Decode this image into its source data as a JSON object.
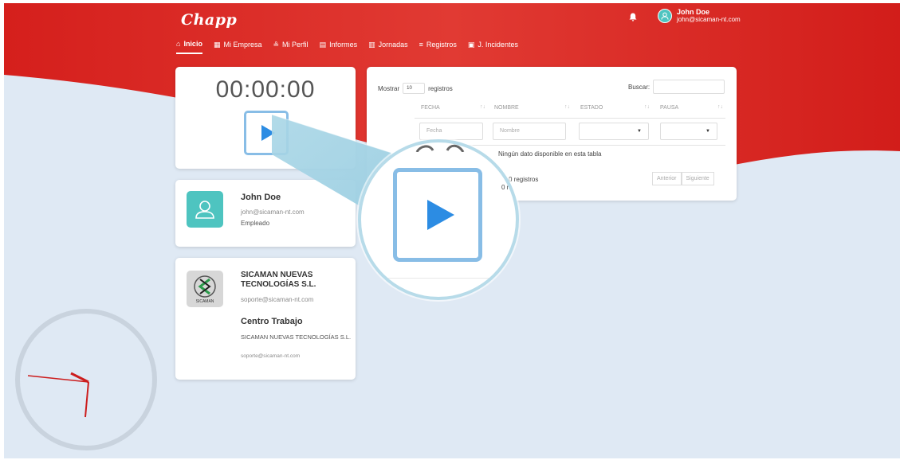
{
  "brand": {
    "logo": "Chapp",
    "accent": "#d8231f",
    "accent_light": "#e8403a"
  },
  "nav": [
    {
      "label": "Inicio",
      "icon": "home-icon",
      "active": true
    },
    {
      "label": "Mi Empresa",
      "icon": "building-icon"
    },
    {
      "label": "Mi Perfil",
      "icon": "person-icon"
    },
    {
      "label": "Informes",
      "icon": "document-icon"
    },
    {
      "label": "Jornadas",
      "icon": "calendar-icon"
    },
    {
      "label": "Registros",
      "icon": "list-icon"
    },
    {
      "label": "J. Incidentes",
      "icon": "calendar-alert-icon"
    }
  ],
  "topbar_user": {
    "name": "John Doe",
    "email": "john@sicaman-nt.com"
  },
  "timer": {
    "value": "00:00:00"
  },
  "user_card": {
    "name": "John Doe",
    "email": "john@sicaman-nt.com",
    "role": "Empleado"
  },
  "company_card": {
    "logo_label": "SICAMAN",
    "name": "SICAMAN NUEVAS TECNOLOGÍAS S.L.",
    "email": "soporte@sicaman-nt.com",
    "centro_heading": "Centro Trabajo",
    "centro_name": "SICAMAN NUEVAS TECNOLOGÍAS S.L.",
    "centro_email": "soporte@sicaman-nt.com"
  },
  "table": {
    "show_prefix": "Mostrar",
    "show_value": "10",
    "show_suffix": "registros",
    "search_label": "Buscar:",
    "columns": [
      "FECHA",
      "NOMBRE",
      "ESTADO",
      "PAUSA"
    ],
    "filters": {
      "fecha_placeholder": "Fecha",
      "nombre_placeholder": "Nombre"
    },
    "empty_message": "Ningún dato disponible en esta tabla",
    "info_fragment": "0 registros",
    "prev_label": "Anterior",
    "next_label": "Siguiente"
  },
  "magnifier": {
    "empty_message": "Ningún dato disponible en esta tabla",
    "info_fragment": "0 registros"
  }
}
